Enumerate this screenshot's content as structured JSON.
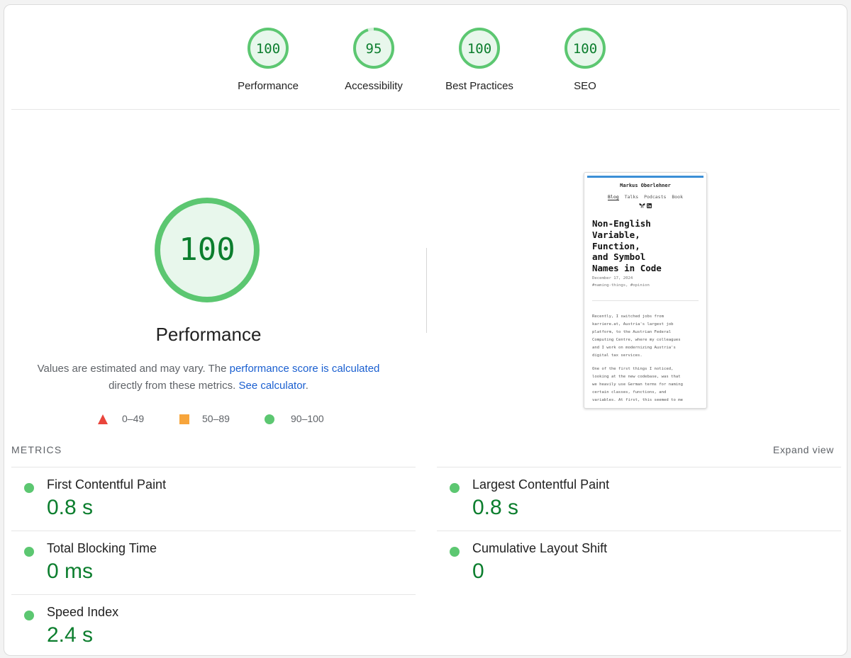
{
  "colors": {
    "pass": "#0c7e2e",
    "pass_ring": "#5cc771",
    "pass_fill": "#e8f7ec",
    "average": "#f7a53c",
    "fail": "#e9453c"
  },
  "categories": [
    {
      "label": "Performance",
      "score": 100
    },
    {
      "label": "Accessibility",
      "score": 95
    },
    {
      "label": "Best Practices",
      "score": 100
    },
    {
      "label": "SEO",
      "score": 100
    }
  ],
  "performance": {
    "score": "100",
    "title": "Performance",
    "desc_prefix": "Values are estimated and may vary. The",
    "desc_link": "performance score is calculated",
    "desc_mid": "directly from these metrics.",
    "calc_link": "See calculator",
    "desc_end": "."
  },
  "legend": [
    {
      "icon": "triangle-icon",
      "range": "0–49"
    },
    {
      "icon": "square-icon",
      "range": "50–89"
    },
    {
      "icon": "circle-icon",
      "range": "90–100"
    }
  ],
  "screenshot": {
    "site_name": "Markus Oberlehner",
    "nav": [
      "Blog",
      "Talks",
      "Podcasts",
      "Book"
    ],
    "nav_active": "Blog",
    "social_icons": [
      "butterfly-icon",
      "linkedin-icon"
    ],
    "title_lines": [
      "Non-English",
      "Variable,",
      "Function,",
      "and Symbol",
      "Names in Code"
    ],
    "date": "December 17, 2024",
    "tags": "#naming-things, #opinion",
    "paragraph1_lines": [
      "Recently, I switched jobs from",
      "karriere.at, Austria's largest job",
      "platform, to the Austrian Federal",
      "Computing Centre, where my colleagues",
      "and I work on modernizing Austria's",
      "digital tax services."
    ],
    "paragraph2_lines": [
      "One of the first things I noticed,",
      "looking at the new codebase, was that",
      "we heavily use German terms for naming",
      "certain classes, functions, and",
      "variables. At first, this seemed to me"
    ]
  },
  "metrics": {
    "header": "METRICS",
    "expand": "Expand view",
    "items": [
      {
        "label": "First Contentful Paint",
        "value": "0.8 s"
      },
      {
        "label": "Largest Contentful Paint",
        "value": "0.8 s"
      },
      {
        "label": "Total Blocking Time",
        "value": "0 ms"
      },
      {
        "label": "Cumulative Layout Shift",
        "value": "0"
      },
      {
        "label": "Speed Index",
        "value": "2.4 s"
      }
    ]
  }
}
